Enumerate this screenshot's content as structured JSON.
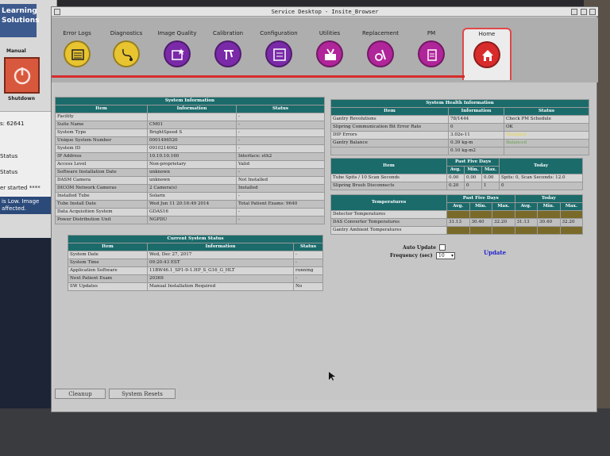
{
  "window": {
    "title": "Service Desktop - Insite_Browser"
  },
  "left_app": {
    "logo_line1": "Learning",
    "logo_line2": "Solutions",
    "mode": "Manual",
    "shutdown_label": "Shutdown",
    "lines": [
      {
        "text": "s:   62641"
      },
      {
        "text": "Status"
      },
      {
        "text": "Status"
      },
      {
        "text": "er started ****"
      }
    ],
    "alert_line1": "is Low. Image",
    "alert_line2": "affected."
  },
  "toolbar": {
    "items": [
      {
        "label": "Error Logs",
        "color": "#e8c430",
        "icon": "log-icon"
      },
      {
        "label": "Diagnostics",
        "color": "#e8c430",
        "icon": "stethoscope-icon"
      },
      {
        "label": "Image Quality",
        "color": "#7a2aa8",
        "icon": "image-quality-icon"
      },
      {
        "label": "Calibration",
        "color": "#7a2aa8",
        "icon": "calibration-icon"
      },
      {
        "label": "Configuration",
        "color": "#7a2aa8",
        "icon": "configuration-icon"
      },
      {
        "label": "Utilities",
        "color": "#b0259a",
        "icon": "utilities-icon"
      },
      {
        "label": "Replacement",
        "color": "#b0259a",
        "icon": "replacement-icon"
      },
      {
        "label": "PM",
        "color": "#b0259a",
        "icon": "pm-icon"
      }
    ],
    "home_label": "Home",
    "home_color": "#d82b2b"
  },
  "system_info": {
    "title": "System Information",
    "headers": [
      "Item",
      "Information",
      "Status"
    ],
    "rows": [
      [
        "Facility",
        "",
        "-"
      ],
      [
        "Suite Name",
        "CM01",
        "-"
      ],
      [
        "System Type",
        "BrightSpeed S",
        "-"
      ],
      [
        "Unique System Number",
        "0001496520",
        "-"
      ],
      [
        "System ID",
        "0910214062",
        "-"
      ],
      [
        "IP Address",
        "10.10.10.160",
        "Interface: eth2"
      ],
      [
        "Access Level",
        "Non-proprietary",
        "Valid"
      ],
      [
        "Software Installation Date",
        "unknown",
        "-"
      ],
      [
        "DASM Camera",
        "unknown",
        "Not Installed"
      ],
      [
        "DICOM Network Cameras",
        "2 Camera(s)",
        "Installed"
      ],
      [
        "Installed Tube",
        "Solarix",
        "-"
      ],
      [
        "Tube Install Date",
        "Wed Jun 11 20:16:49 2014",
        "Total Patient Exams: 9640"
      ],
      [
        "Data Acquisition System",
        "GDAS16",
        "-"
      ],
      [
        "Power Distribution Unit",
        "NGPDU",
        "-"
      ]
    ]
  },
  "current_status": {
    "title": "Current System Status",
    "headers": [
      "Item",
      "Information",
      "Status"
    ],
    "rows": [
      [
        "System Date",
        "Wed, Dec 27, 2017",
        "-"
      ],
      [
        "System Time",
        "09:20:43 EST",
        "-"
      ],
      [
        "Application Software",
        "11BW46.1_SP1-9-1.HP_S_G16_G_HLT",
        "running"
      ],
      [
        "Next Patient Exam",
        "20369",
        "-"
      ],
      [
        "SW Updates",
        "Manual Installation Required",
        "No"
      ]
    ]
  },
  "health": {
    "title": "System Health Information",
    "headers": [
      "Item",
      "Information",
      "Status"
    ],
    "rows": [
      [
        "Gantry Revolutions",
        "78/1444",
        "Check PM Schedule"
      ],
      [
        "Slipring Communication Bit Error Rate",
        "0",
        "OK"
      ],
      [
        "DIP Errors",
        "3.02e-11",
        "Marginal"
      ],
      [
        "Gantry Balance",
        "0.39 kg-m",
        "Balanced"
      ],
      [
        "",
        "0.10 kg-m2",
        ""
      ]
    ],
    "spits_header": {
      "item": "Item",
      "past": "Past Five Days",
      "today": "Today",
      "avg": "Avg.",
      "min": "Min.",
      "max": "Max."
    },
    "spits_rows": [
      [
        "Tube Spits / 10 Scan Seconds",
        "0.00",
        "0.00",
        "0.00",
        "Spits: 0, Scan Seconds: 12.0"
      ],
      [
        "Slipring Brush Disconnects",
        "0.20",
        "0",
        "1",
        "0"
      ]
    ],
    "temps_header": {
      "item": "Temperatures",
      "past": "Past Five Days",
      "today": "Today",
      "avg": "Avg.",
      "min": "Min.",
      "max": "Max."
    },
    "temps_rows": [
      [
        "Detector Temperatures",
        "",
        "",
        "",
        "",
        "",
        ""
      ],
      [
        "DAS Converter Temperatures",
        "31.13",
        "30.40",
        "32.20",
        "31.13",
        "30.40",
        "32.20"
      ],
      [
        "Gantry Ambient Temperatures",
        "",
        "",
        "",
        "",
        "",
        ""
      ]
    ]
  },
  "controls": {
    "auto_update": "Auto Update",
    "frequency_label": "Frequency (sec)",
    "frequency_value": "10",
    "update_link": "Update"
  },
  "bottom": {
    "cleanup": "Cleanup",
    "system_resets": "System Resets"
  }
}
